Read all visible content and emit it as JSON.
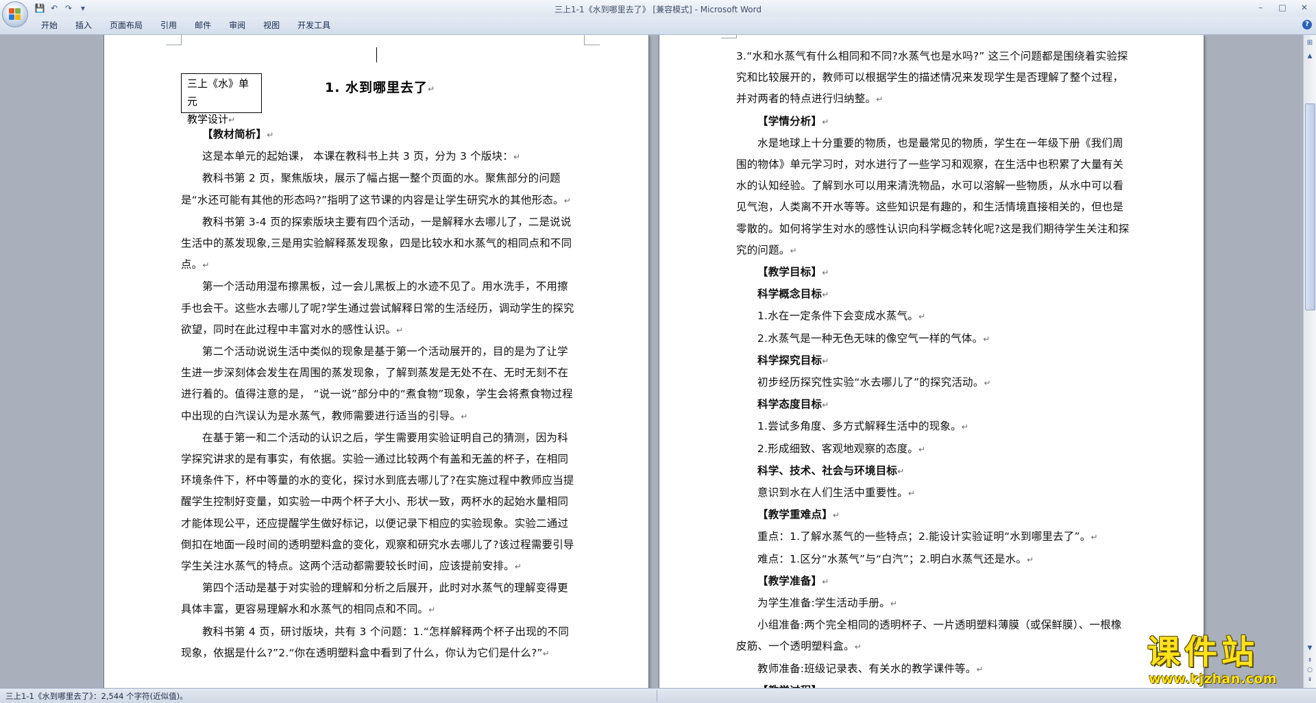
{
  "window": {
    "title": "三上1-1《水到哪里去了》 [兼容模式] - Microsoft Word"
  },
  "quick_access": {
    "icons": [
      "save-icon",
      "undo-icon",
      "redo-icon",
      "customize-icon"
    ],
    "save": "💾",
    "undo": "↶",
    "redo": "↷",
    "customize": "▾"
  },
  "window_controls": {
    "minimize": "–",
    "maximize": "□",
    "close": "✕"
  },
  "ribbon": {
    "tabs": [
      "开始",
      "插入",
      "页面布局",
      "引用",
      "邮件",
      "审阅",
      "视图",
      "开发工具"
    ],
    "help": "?"
  },
  "document": {
    "unit_box": {
      "line1": "三上《水》单元",
      "line2": "教学设计"
    },
    "title": "1. 水到哪里去了",
    "para_mark": "↵",
    "left_paragraphs": [
      {
        "style": "h",
        "text": "【教材简析】"
      },
      {
        "style": "p",
        "text": "这是本单元的起始课， 本课在教科书上共 3 页，分为 3 个版块："
      },
      {
        "style": "p",
        "text": "教科书第 2 页，聚焦版块，展示了幅占据一整个页面的水。聚焦部分的问题是“水还可能有其他的形态吗?”指明了这节课的内容是让学生研究水的其他形态。"
      },
      {
        "style": "p",
        "text": "教科书第 3-4 页的探索版块主要有四个活动，一是解释水去哪儿了，二是说说生活中的蒸发现象,三是用实验解释蒸发现象，四是比较水和水蒸气的相同点和不同点。"
      },
      {
        "style": "p",
        "text": "第一个活动用湿布擦黑板，过一会儿黑板上的水迹不见了。用水洗手，不用擦手也会干。这些水去哪儿了呢?学生通过尝试解释日常的生活经历，调动学生的探究欲望，同时在此过程中丰富对水的感性认识。"
      },
      {
        "style": "p",
        "text": "第二个活动说说生活中类似的现象是基于第一个活动展开的，目的是为了让学生进一步深刻体会发生在周围的蒸发现象，了解到蒸发是无处不在、无时无刻不在进行着的。值得注意的是， “说一说”部分中的“煮食物”现象，学生会将煮食物过程中出现的白汽误认为是水蒸气，教师需要进行适当的引导。"
      },
      {
        "style": "p",
        "text": "在基于第一和二个活动的认识之后，学生需要用实验证明自己的猜测，因为科学探究讲求的是有事实，有依据。实验一通过比较两个有盖和无盖的杯子，在相同环境条件下，杯中等量的水的变化，探讨水到底去哪儿了?在实施过程中教师应当提醒学生控制好变量，如实验一中两个杯子大小、形状一致，两杯水的起始水量相同才能体现公平，还应提醒学生做好标记，以便记录下相应的实验现象。实验二通过倒扣在地面一段时间的透明塑料盒的变化，观察和研究水去哪儿了?该过程需要引导学生关注水蒸气的特点。这两个活动都需要较长时间，应该提前安排。"
      },
      {
        "style": "p",
        "text": "第四个活动是基于对实验的理解和分析之后展开，此时对水蒸气的理解变得更具体丰富，更容易理解水和水蒸气的相同点和不同。"
      },
      {
        "style": "p",
        "text": "教科书第 4 页，研讨版块，共有 3 个问题：1.“怎样解释两个杯子出现的不同现象，依据是什么?”2.“你在透明塑料盒中看到了什么，你认为它们是什么?”"
      }
    ],
    "right_paragraphs": [
      {
        "style": "p0",
        "text": "3.“水和水蒸气有什么相同和不同?水蒸气也是水吗?” 这三个问题都是围绕着实验探究和比较展开的，教师可以根据学生的描述情况来发现学生是否理解了整个过程，并对两者的特点进行归纳整。"
      },
      {
        "style": "h",
        "text": "【学情分析】"
      },
      {
        "style": "p",
        "text": "水是地球上十分重要的物质，也是最常见的物质，学生在一年级下册《我们周围的物体》单元学习时，对水进行了一些学习和观察，在生活中也积累了大量有关水的认知经验。了解到水可以用来清洗物品，水可以溶解一些物质，从水中可以看见气泡，人类离不开水等等。这些知识是有趣的，和生活情境直接相关的，但也是零散的。如何将学生对水的感性认识向科学概念转化呢?这是我们期待学生关注和探究的问题。"
      },
      {
        "style": "h",
        "text": "【教学目标】"
      },
      {
        "style": "hi",
        "text": "科学概念目标"
      },
      {
        "style": "pi",
        "text": "1.水在一定条件下会变成水蒸气。"
      },
      {
        "style": "pi",
        "text": "2.水蒸气是一种无色无味的像空气一样的气体。"
      },
      {
        "style": "hi",
        "text": "科学探究目标"
      },
      {
        "style": "pi",
        "text": "初步经历探究性实验“水去哪儿了”的探究活动。"
      },
      {
        "style": "hi",
        "text": "科学态度目标"
      },
      {
        "style": "pi",
        "text": "1.尝试多角度、多方式解释生活中的现象。"
      },
      {
        "style": "pi",
        "text": "2.形成细致、客观地观察的态度。"
      },
      {
        "style": "hi",
        "text": "科学、技术、社会与环境目标"
      },
      {
        "style": "pi",
        "text": "意识到水在人们生活中重要性。"
      },
      {
        "style": "h",
        "text": "【教学重难点】"
      },
      {
        "style": "pi",
        "text": "重点：1.了解水蒸气的一些特点；2.能设计实验证明“水到哪里去了”。"
      },
      {
        "style": "pi",
        "text": "难点：1.区分“水蒸气”与“白汽”；2.明白水蒸气还是水。"
      },
      {
        "style": "h",
        "text": "【教学准备】"
      },
      {
        "style": "pi",
        "text": "为学生准备:学生活动手册。"
      },
      {
        "style": "pi2",
        "text": "小组准备:两个完全相同的透明杯子、一片透明塑料薄膜（或保鲜膜）、一根橡皮筋、一个透明塑料盒。"
      },
      {
        "style": "pi",
        "text": "教师准备:班级记录表、有关水的教学课件等。"
      },
      {
        "style": "h",
        "text": "【教学过程】"
      }
    ]
  },
  "scrollbar": {
    "ruler": "⊞",
    "up": "▲",
    "down": "▼",
    "prev": "⇞",
    "browse": "○",
    "next": "⇟"
  },
  "status": {
    "text": "三上1-1《水到哪里去了》：2,544 个字符(近似值)。"
  },
  "watermark": {
    "main": "课件站",
    "url": "www.kjzhan.com"
  },
  "colors": {
    "ribbon_bg": "#dfe6f0",
    "doc_bg": "#a9b0bc",
    "watermark": "#ffe21a"
  }
}
